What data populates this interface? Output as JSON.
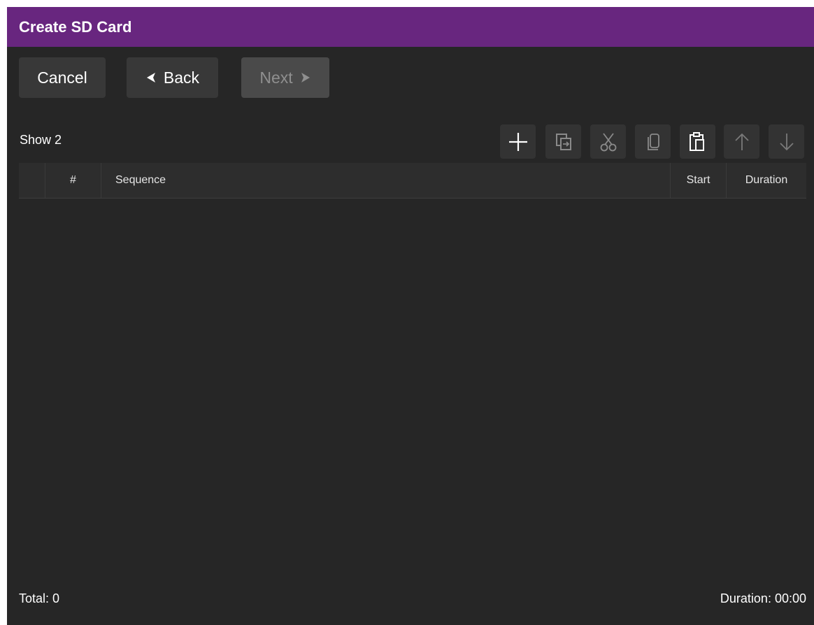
{
  "window": {
    "title": "Create SD Card"
  },
  "nav": {
    "cancel_label": "Cancel",
    "back_label": "Back",
    "next_label": "Next"
  },
  "show": {
    "label": "Show 2"
  },
  "toolbar": {
    "icons": [
      "add-icon",
      "duplicate-icon",
      "cut-icon",
      "copy-icon",
      "paste-icon",
      "move-up-icon",
      "move-down-icon"
    ],
    "enabled": [
      true,
      false,
      false,
      false,
      true,
      false,
      false
    ]
  },
  "table": {
    "columns": [
      "#",
      "Sequence",
      "Start",
      "Duration"
    ],
    "rows": []
  },
  "footer": {
    "total": "Total: 0",
    "duration": "Duration: 00:00"
  },
  "colors": {
    "titlebar": "#68267f",
    "background": "#262626",
    "button": "#383838",
    "button_disabled": "#4a4a4a"
  }
}
